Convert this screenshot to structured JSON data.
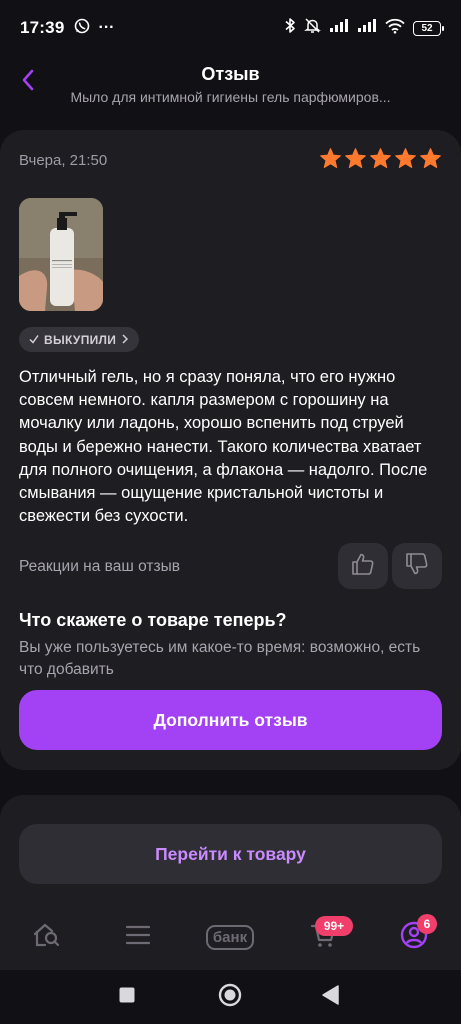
{
  "status_bar": {
    "time": "17:39",
    "more": "···",
    "battery": "52",
    "icons": [
      "whatsapp-icon",
      "bluetooth-icon",
      "mute-icon",
      "signal-icon",
      "signal-icon",
      "wifi-icon",
      "battery-icon"
    ]
  },
  "header": {
    "title": "Отзыв",
    "subtitle": "Мыло для интимной гигиены гель парфюмиров..."
  },
  "review": {
    "date": "Вчера, 21:50",
    "rating": 5,
    "star_color": "#ff7a2e",
    "photo_label": "bona",
    "purchased_badge": "ВЫКУПИЛИ",
    "text": "Отличный гель, но я сразу поняла, что его нужно совсем немного. капля размером с горошину на мочалку или ладонь, хорошо вспенить под струей воды и бережно нанести. Такого количества хватает для полного очищения, а флакона — надолго. После смывания — ощущение кристальной чистоты и свежести без сухости.",
    "reactions_label": "Реакции на ваш отзыв"
  },
  "prompt": {
    "title": "Что скажете о товаре теперь?",
    "text": "Вы уже пользуетесь им какое-то время: возможно, есть что добавить",
    "button_label": "Дополнить отзыв"
  },
  "go_to_product_label": "Перейти к товару",
  "tab_bar": {
    "bank_label": "банк",
    "cart_badge": "99+",
    "profile_badge": "6"
  },
  "colors": {
    "accent": "#a341f5",
    "accent_text": "#c98bff",
    "badge": "#ef3f6a",
    "background": "#111014",
    "card": "#1e1d22"
  }
}
